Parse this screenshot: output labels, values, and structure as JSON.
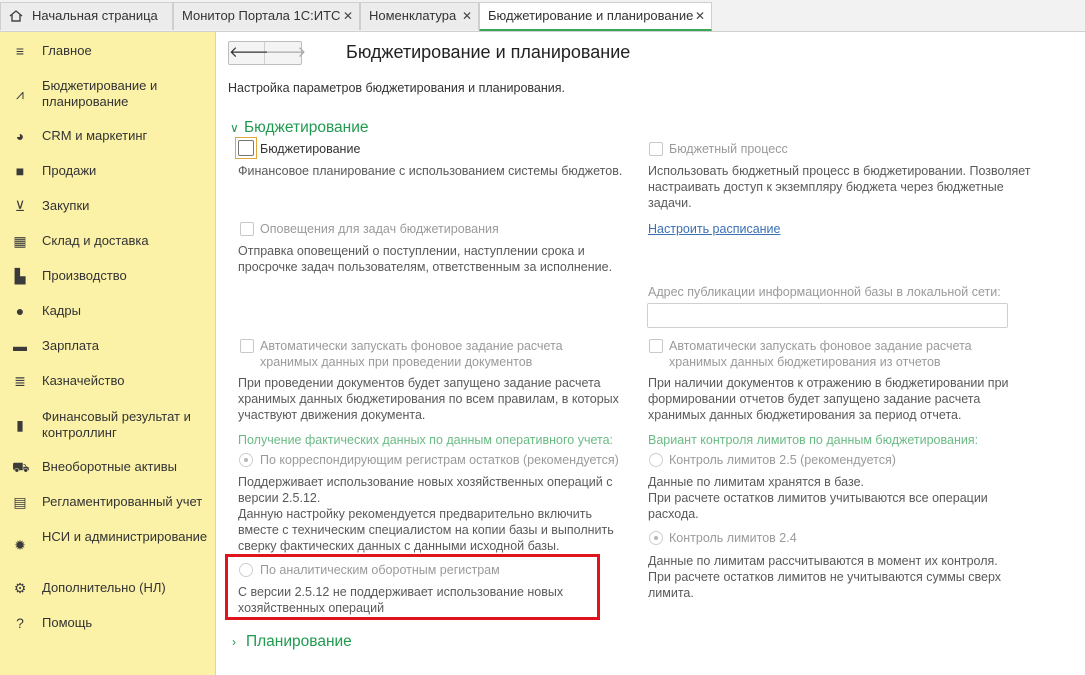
{
  "tabs": [
    {
      "label": "Начальная страница",
      "close": ""
    },
    {
      "label": "Монитор Портала 1С:ИТС",
      "close": "✕"
    },
    {
      "label": "Номенклатура",
      "close": "✕"
    },
    {
      "label": "Бюджетирование и планирование",
      "close": "✕"
    }
  ],
  "sidebar": {
    "items": [
      {
        "label": "Главное",
        "icon": "menu-icon"
      },
      {
        "label": "Бюджетирование и планирование",
        "icon": "budget-chart-icon"
      },
      {
        "label": "CRM и маркетинг",
        "icon": "pie-chart-icon"
      },
      {
        "label": "Продажи",
        "icon": "shopping-bag-icon"
      },
      {
        "label": "Закупки",
        "icon": "cart-icon"
      },
      {
        "label": "Склад и доставка",
        "icon": "warehouse-grid-icon"
      },
      {
        "label": "Производство",
        "icon": "factory-icon"
      },
      {
        "label": "Кадры",
        "icon": "person-icon"
      },
      {
        "label": "Зарплата",
        "icon": "card-icon"
      },
      {
        "label": "Казначейство",
        "icon": "coins-icon"
      },
      {
        "label": "Финансовый результат и контроллинг",
        "icon": "bar-chart-icon"
      },
      {
        "label": "Внеоборотные активы",
        "icon": "truck-icon"
      },
      {
        "label": "Регламентированный учет",
        "icon": "document-icon"
      },
      {
        "label": "НСИ и администрирование",
        "icon": "gear-icon"
      },
      {
        "label": "Дополнительно (НЛ)",
        "icon": "gear-outline-icon"
      },
      {
        "label": "Помощь",
        "icon": "help-icon"
      }
    ]
  },
  "main": {
    "title": "Бюджетирование и планирование",
    "description": "Настройка параметров бюджетирования и планирования.",
    "group_budgeting": "Бюджетирование",
    "group_planning": "Планирование",
    "left": {
      "budgeting_cb": "Бюджетирование",
      "budgeting_note": "Финансовое планирование с использованием системы бюджетов.",
      "notify_cb": "Оповещения для задач бюджетирования",
      "notify_note": [
        "Отправка оповещений о поступлении, наступлении срока и",
        "просрочке задач пользователям, ответственным за исполнение."
      ],
      "auto_docs_cb": [
        "Автоматически запускать фоновое задание расчета",
        "хранимых данных при проведении документов"
      ],
      "auto_docs_note": [
        "При проведении документов будет запущено задание расчета",
        "хранимых данных бюджетирования по всем правилам, в которых",
        "участвуют движения документа."
      ],
      "fact_header": "Получение фактических данных по данным оперативного учета:",
      "radio1": "По корреспондирующим регистрам остатков (рекомендуется)",
      "radio1_note": [
        "Поддерживает использование новых хозяйственных операций с",
        "версии 2.5.12.",
        "Данную настройку рекомендуется предварительно включить",
        "вместе с техническим специалистом на копии базы и выполнить",
        "сверку фактических данных с данными исходной базы."
      ],
      "radio2": "По аналитическим оборотным регистрам",
      "radio2_note": [
        "С версии 2.5.12 не поддерживает использование новых",
        "хозяйственных операций"
      ]
    },
    "right": {
      "process_cb": "Бюджетный процесс",
      "process_note": [
        "Использовать бюджетный процесс в бюджетировании. Позволяет",
        "настраивать доступ к экземпляру бюджета через бюджетные",
        "задачи."
      ],
      "schedule_link": "Настроить расписание",
      "address_label": "Адрес публикации информационной базы в локальной сети:",
      "address_value": "",
      "auto_reports_cb": [
        "Автоматически запускать фоновое задание расчета",
        "хранимых данных бюджетирования из отчетов"
      ],
      "auto_reports_note": [
        "При наличии документов к отражению в бюджетировании при",
        "формировании отчетов будет запущено задание расчета",
        "хранимых данных бюджетирования за период отчета."
      ],
      "limits_header": "Вариант контроля лимитов по данным бюджетирования:",
      "limits1": "Контроль лимитов 2.5 (рекомендуется)",
      "limits1_note": [
        "Данные по лимитам хранятся в базе.",
        "При расчете остатков лимитов учитываются все операции",
        "расхода."
      ],
      "limits2": "Контроль лимитов 2.4",
      "limits2_note": [
        "Данные по лимитам рассчитываются в момент их контроля.",
        "При расчете остатков лимитов не учитываются суммы сверх",
        "лимита."
      ]
    }
  }
}
